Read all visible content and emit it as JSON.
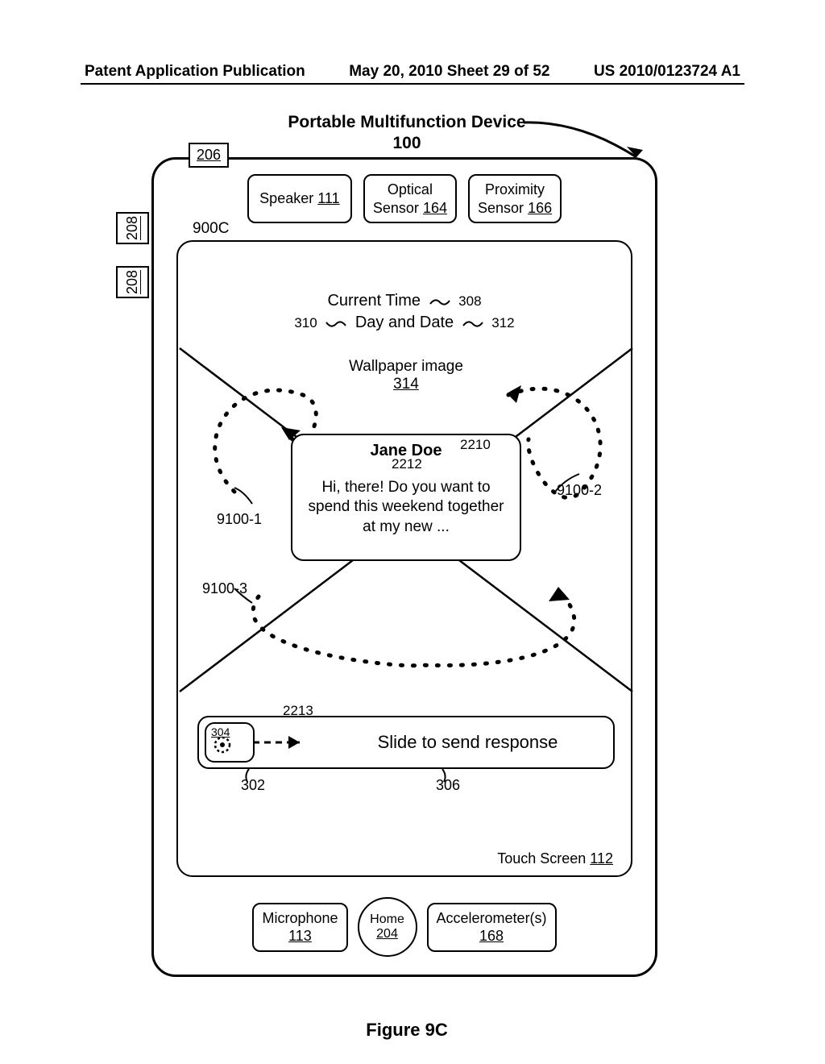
{
  "header": {
    "left": "Patent Application Publication",
    "center": "May 20, 2010  Sheet 29 of 52",
    "right": "US 2010/0123724 A1"
  },
  "title": {
    "line1": "Portable Multifunction Device",
    "ref": "100"
  },
  "refs": {
    "r206": "206",
    "r208": "208",
    "r900c": "900C",
    "r308": "308",
    "r310": "310",
    "r312": "312",
    "r314": "314",
    "r2210": "2210",
    "r2212": "2212",
    "r9100_1": "9100-1",
    "r9100_2": "9100-2",
    "r9100_3": "9100-3",
    "r2213": "2213",
    "r302": "302",
    "r304": "304",
    "r306": "306"
  },
  "sensors": {
    "speaker": {
      "label": "Speaker",
      "num": "111"
    },
    "optical": {
      "label1": "Optical",
      "label2": "Sensor",
      "num": "164"
    },
    "proximity": {
      "label1": "Proximity",
      "label2": "Sensor",
      "num": "166"
    }
  },
  "screen": {
    "current_time": "Current Time",
    "day_date": "Day and Date",
    "wallpaper": "Wallpaper image",
    "touch_label": "Touch Screen",
    "touch_num": "112"
  },
  "message": {
    "sender": "Jane Doe",
    "body": "Hi, there! Do you want to spend this weekend together at my new ..."
  },
  "slider": {
    "text": "Slide to send response"
  },
  "bottom": {
    "mic": {
      "label": "Microphone",
      "num": "113"
    },
    "home": {
      "label": "Home",
      "num": "204"
    },
    "accel": {
      "label": "Accelerometer(s)",
      "num": "168"
    }
  },
  "caption": "Figure 9C"
}
